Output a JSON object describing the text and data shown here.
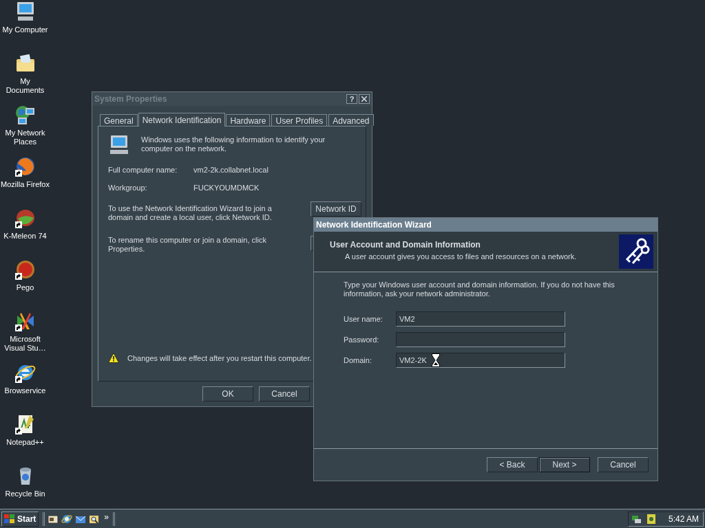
{
  "desktop_icons": [
    {
      "label": "My Computer",
      "kind": "computer",
      "shortcut": false
    },
    {
      "label": "My Documents",
      "kind": "folder",
      "shortcut": false
    },
    {
      "label": "My Network Places",
      "kind": "network",
      "shortcut": false
    },
    {
      "label": "Mozilla Firefox",
      "kind": "firefox",
      "shortcut": true
    },
    {
      "label": "K-Meleon 74",
      "kind": "kmeleon",
      "shortcut": true
    },
    {
      "label": "Pego",
      "kind": "pego",
      "shortcut": true
    },
    {
      "label": "Microsoft Visual Stu…",
      "kind": "studio",
      "shortcut": true
    },
    {
      "label": "Browservice",
      "kind": "ie",
      "shortcut": true
    },
    {
      "label": "Notepad++",
      "kind": "notepad",
      "shortcut": true
    },
    {
      "label": "Recycle Bin",
      "kind": "recycle",
      "shortcut": false
    }
  ],
  "system_properties": {
    "title": "System Properties",
    "active": false,
    "help_button": "?",
    "tabs": [
      {
        "label": "General",
        "selected": false
      },
      {
        "label": "Network Identification",
        "selected": true
      },
      {
        "label": "Hardware",
        "selected": false
      },
      {
        "label": "User Profiles",
        "selected": false
      },
      {
        "label": "Advanced",
        "selected": false
      }
    ],
    "intro": "Windows uses the following information to identify your computer on the network.",
    "fields": [
      {
        "label": "Full computer name:",
        "value": "vm2-2k.collabnet.local"
      },
      {
        "label": "Workgroup:",
        "value": "FUCKYOUMDMCK"
      }
    ],
    "network_id_text": "To use the Network Identification Wizard to join a domain and create a local user, click Network ID.",
    "network_id_button": "Network ID",
    "rename_text": "To rename this computer or join a domain, click Properties.",
    "warning": "Changes will take effect after you restart this computer.",
    "buttons": [
      "OK",
      "Cancel"
    ]
  },
  "wizard": {
    "title": "Network Identification Wizard",
    "active": true,
    "heading": "User Account and Domain Information",
    "subheading": "A user account gives you access to files and resources on a network.",
    "instructions": "Type your Windows user account and domain information. If you do not have this information, ask your network administrator.",
    "fields": [
      {
        "label": "User name:",
        "value": "VM2"
      },
      {
        "label": "Password:"
      },
      {
        "label": "Domain:",
        "value": "VM2-2K"
      }
    ],
    "buttons": [
      {
        "label": "< Back",
        "focused": false
      },
      {
        "label": "Next >",
        "focused": true
      },
      {
        "label": "Cancel",
        "focused": false
      }
    ]
  },
  "taskbar": {
    "start": "Start",
    "chevron": "»",
    "clock": "5:42 AM"
  }
}
